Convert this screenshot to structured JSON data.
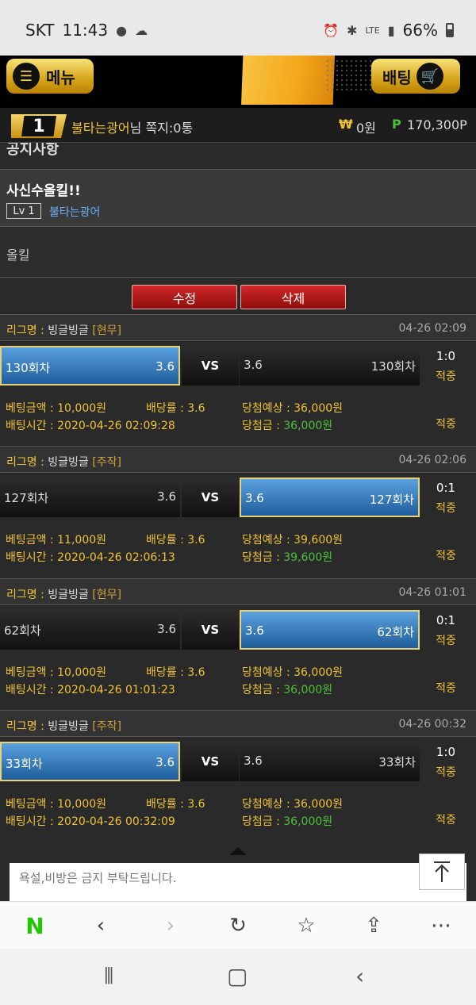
{
  "statusbar": {
    "carrier": "SKT",
    "time": "11:43",
    "signal_text": "LTE",
    "battery": "66%"
  },
  "header": {
    "menu_label": "메뉴",
    "bet_label": "배팅"
  },
  "user": {
    "rank": "1",
    "name": "불타는광어",
    "suffix": "님",
    "message": "쪽지:0통",
    "won_symbol": "₩",
    "won": "0원",
    "point_symbol": "P",
    "points": "170,300P"
  },
  "notice": {
    "heading": "공지사항"
  },
  "post": {
    "title": "사신수올킬!!",
    "level": "Lv 1",
    "author": "불타는광어",
    "body": "올킬"
  },
  "buttons": {
    "edit": "수정",
    "delete": "삭제"
  },
  "labels": {
    "league": "리그명 : ",
    "vs": "VS",
    "bet_amount": "베팅금액 : ",
    "odds": "배당률 : ",
    "expected": "당첨예상 : ",
    "bet_time": "배팅시간 : ",
    "win_amount": "당첨금 : "
  },
  "bets": [
    {
      "league": "빙글빙글",
      "type": "[현무]",
      "time": "04-26 02:09",
      "home": "130회차",
      "home_odds": "3.6",
      "away": "130회차",
      "away_odds": "3.6",
      "selected": "home",
      "score": "1:0",
      "result": "적중",
      "amount": "10,000원",
      "odds": "3.6",
      "expected": "36,000원",
      "bet_time": "2020-04-26 02:09:28",
      "win": "36,000원"
    },
    {
      "league": "빙글빙글",
      "type": "[주작]",
      "time": "04-26 02:06",
      "home": "127회차",
      "home_odds": "3.6",
      "away": "127회차",
      "away_odds": "3.6",
      "selected": "away",
      "score": "0:1",
      "result": "적중",
      "amount": "11,000원",
      "odds": "3.6",
      "expected": "39,600원",
      "bet_time": "2020-04-26 02:06:13",
      "win": "39,600원"
    },
    {
      "league": "빙글빙글",
      "type": "[현무]",
      "time": "04-26 01:01",
      "home": "62회차",
      "home_odds": "3.6",
      "away": "62회차",
      "away_odds": "3.6",
      "selected": "away",
      "score": "0:1",
      "result": "적중",
      "amount": "10,000원",
      "odds": "3.6",
      "expected": "36,000원",
      "bet_time": "2020-04-26 01:01:23",
      "win": "36,000원"
    },
    {
      "league": "빙글빙글",
      "type": "[주작]",
      "time": "04-26 00:32",
      "home": "33회차",
      "home_odds": "3.6",
      "away": "33회차",
      "away_odds": "3.6",
      "selected": "home",
      "score": "1:0",
      "result": "적중",
      "amount": "10,000원",
      "odds": "3.6",
      "expected": "36,000원",
      "bet_time": "2020-04-26 00:32:09",
      "win": "36,000원"
    }
  ],
  "comment": {
    "placeholder": "욕설,비방은 금지 부탁드립니다."
  },
  "browser": {
    "home_glyph": "N"
  }
}
